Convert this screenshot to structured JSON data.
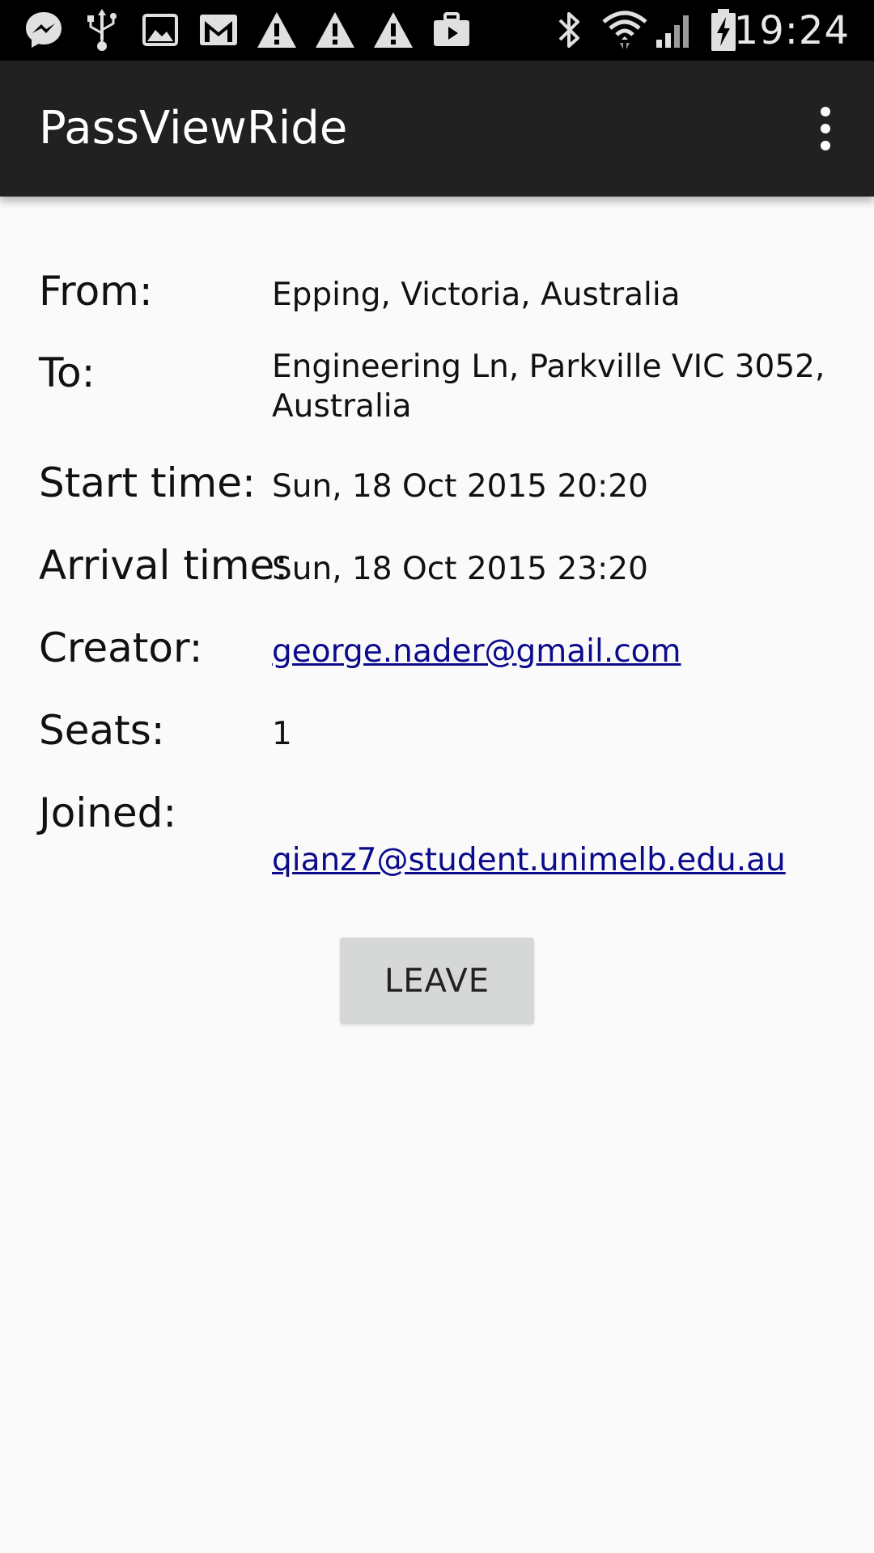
{
  "status_bar": {
    "time": "19:24",
    "left_icons": [
      "messenger-icon",
      "usb-icon",
      "image-icon",
      "gmail-icon",
      "warning-icon",
      "warning-icon",
      "warning-icon",
      "briefcase-icon"
    ],
    "right_icons": [
      "bluetooth-icon",
      "wifi-icon",
      "signal-icon",
      "battery-charging-icon"
    ]
  },
  "app_bar": {
    "title": "PassViewRide",
    "overflow_icon": "more-vert-icon"
  },
  "details": {
    "from_label": "From:",
    "from_value": "Epping, Victoria, Australia",
    "to_label": "To:",
    "to_value": "Engineering Ln, Parkville VIC 3052, Australia",
    "start_label": "Start time:",
    "start_value": "Sun, 18 Oct 2015 20:20",
    "arrival_label": "Arrival time:",
    "arrival_value": "Sun, 18 Oct 2015 23:20",
    "creator_label": "Creator:",
    "creator_value": "george.nader@gmail.com",
    "seats_label": "Seats:",
    "seats_value": "1",
    "joined_label": "Joined:",
    "joined_value": "qianz7@student.unimelb.edu.au"
  },
  "actions": {
    "leave_label": "LEAVE"
  },
  "colors": {
    "status_bar_bg": "#000000",
    "app_bar_bg": "#212121",
    "page_bg": "#fafafa",
    "link": "#0b0b8c",
    "button_bg": "#d6d7d7"
  }
}
